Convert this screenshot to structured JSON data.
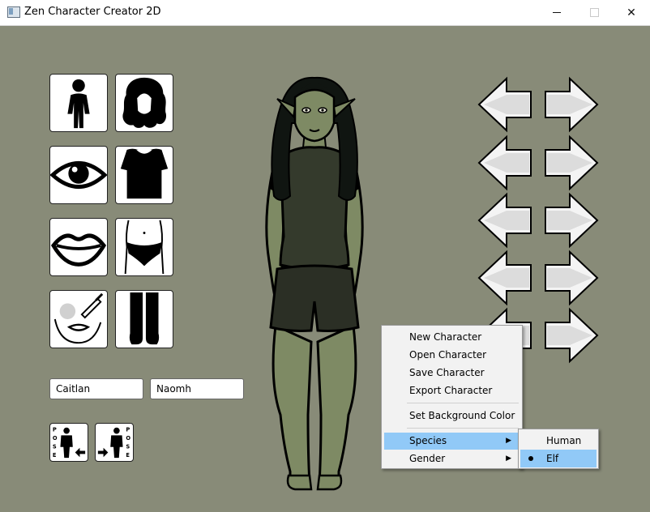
{
  "window": {
    "title": "Zen Character Creator 2D",
    "controls": {
      "minimize": "minimize",
      "maximize": "maximize",
      "close": "✕"
    }
  },
  "colors": {
    "background": "#888b78",
    "menu_highlight": "#91c9f7",
    "menu_bg": "#f2f2f2"
  },
  "category_tiles": [
    {
      "icon": "body-icon"
    },
    {
      "icon": "hair-icon"
    },
    {
      "icon": "eye-icon"
    },
    {
      "icon": "top-icon"
    },
    {
      "icon": "lips-icon"
    },
    {
      "icon": "underwear-icon"
    },
    {
      "icon": "makeup-icon"
    },
    {
      "icon": "boots-icon"
    }
  ],
  "name_fields": {
    "first_name": "Caitlan",
    "last_name": "Naomh"
  },
  "pose_buttons": {
    "label_letters": [
      "P",
      "O",
      "S",
      "E"
    ]
  },
  "context_menu": {
    "items": [
      "New Character",
      "Open Character",
      "Save Character",
      "Export Character",
      "Set Background Color",
      "Species",
      "Gender"
    ],
    "highlighted": "Species"
  },
  "species_submenu": {
    "options": [
      "Human",
      "Elf"
    ],
    "selected": "Elf"
  }
}
